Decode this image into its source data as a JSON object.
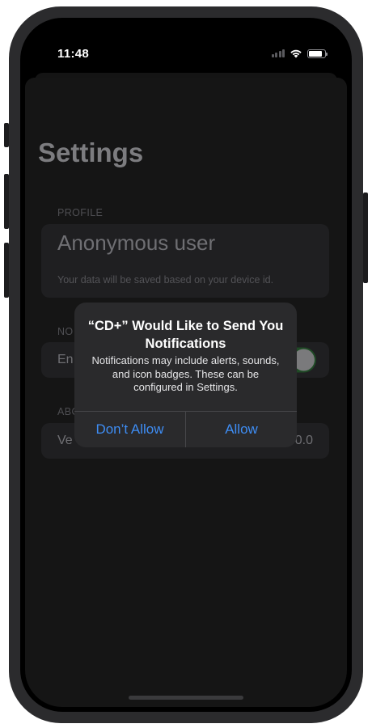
{
  "status_bar": {
    "time": "11:48",
    "signal_icon": "cellular-signal-icon",
    "wifi_icon": "wifi-icon",
    "battery_icon": "battery-icon",
    "battery_level": 0.85
  },
  "settings": {
    "title": "Settings",
    "profile": {
      "header": "PROFILE",
      "name": "Anonymous user",
      "note": "Your data will be saved based on your device id."
    },
    "notifications": {
      "header": "NO",
      "row_label": "En",
      "toggle_on": true
    },
    "about": {
      "header": "ABO",
      "row_label": "Ve",
      "row_value": "0.0"
    }
  },
  "alert": {
    "title": "“CD+” Would Like to Send You Notifications",
    "message": "Notifications may include alerts, sounds, and icon badges. These can be configured in Settings.",
    "deny_label": "Don’t Allow",
    "allow_label": "Allow",
    "button_color": "#3e8df4"
  },
  "colors": {
    "toggle_on_track": "#1f4a25",
    "background": "#000000"
  }
}
